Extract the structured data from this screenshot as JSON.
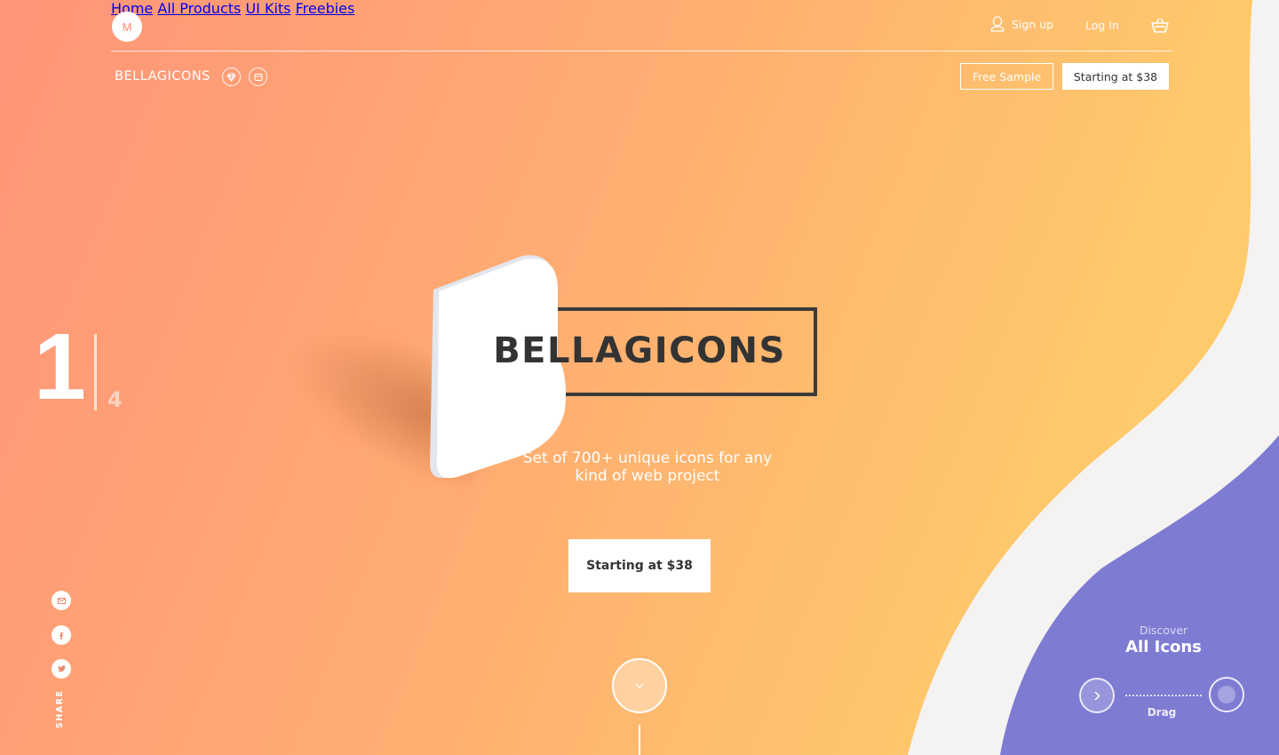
{
  "header": {
    "logo_letter": "M",
    "nav": [
      "Home",
      "All Products",
      "UI Kits",
      "Freebies"
    ],
    "sign_up": "Sign up",
    "log_in": "Log In"
  },
  "subbar": {
    "brand": "BELLAGICONS",
    "free_sample": "Free Sample",
    "starting_price": "Starting at $38"
  },
  "hero": {
    "title": "BELLAGICONS",
    "subtitle": "Set of 700+ unique icons for any kind of web project",
    "cta": "Starting at $38"
  },
  "slide_counter": {
    "current": "1",
    "total": "4"
  },
  "share": {
    "label": "SHARE",
    "icons": [
      "mail-icon",
      "facebook-icon",
      "twitter-icon"
    ]
  },
  "discover": {
    "small": "Discover",
    "big": "All Icons",
    "drag": "Drag"
  },
  "colors": {
    "gradient_start": "#ff9479",
    "gradient_end": "#ffcf6a",
    "wave_light": "#f5f3f1",
    "wave_purple": "#7e7bd3",
    "title_dark": "#333333"
  }
}
